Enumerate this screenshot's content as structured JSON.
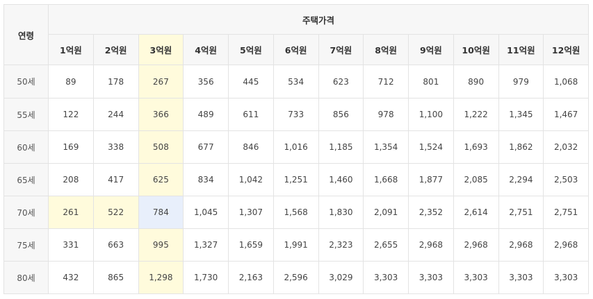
{
  "table": {
    "age_header": "연령",
    "group_header": "주택가격",
    "price_headers": [
      "1억원",
      "2억원",
      "3억원",
      "4억원",
      "5억원",
      "6억원",
      "7억원",
      "8억원",
      "9억원",
      "10억원",
      "11억원",
      "12억원"
    ],
    "rows": [
      {
        "age": "50세",
        "values": [
          "89",
          "178",
          "267",
          "356",
          "445",
          "534",
          "623",
          "712",
          "801",
          "890",
          "979",
          "1,068"
        ]
      },
      {
        "age": "55세",
        "values": [
          "122",
          "244",
          "366",
          "489",
          "611",
          "733",
          "856",
          "978",
          "1,100",
          "1,222",
          "1,345",
          "1,467"
        ]
      },
      {
        "age": "60세",
        "values": [
          "169",
          "338",
          "508",
          "677",
          "846",
          "1,016",
          "1,185",
          "1,354",
          "1,524",
          "1,693",
          "1,862",
          "2,032"
        ]
      },
      {
        "age": "65세",
        "values": [
          "208",
          "417",
          "625",
          "834",
          "1,042",
          "1,251",
          "1,460",
          "1,668",
          "1,877",
          "2,085",
          "2,294",
          "2,503"
        ]
      },
      {
        "age": "70세",
        "values": [
          "261",
          "522",
          "784",
          "1,045",
          "1,307",
          "1,568",
          "1,830",
          "2,091",
          "2,352",
          "2,614",
          "2,751",
          "2,751"
        ]
      },
      {
        "age": "75세",
        "values": [
          "331",
          "663",
          "995",
          "1,327",
          "1,659",
          "1,991",
          "2,323",
          "2,655",
          "2,968",
          "2,968",
          "2,968",
          "2,968"
        ]
      },
      {
        "age": "80세",
        "values": [
          "432",
          "865",
          "1,298",
          "1,730",
          "2,163",
          "2,596",
          "3,029",
          "3,303",
          "3,303",
          "3,303",
          "3,303",
          "3,303"
        ]
      }
    ],
    "highlight_colors": {
      "yellow": "#fffbdc",
      "blue": "#e8effb"
    }
  }
}
